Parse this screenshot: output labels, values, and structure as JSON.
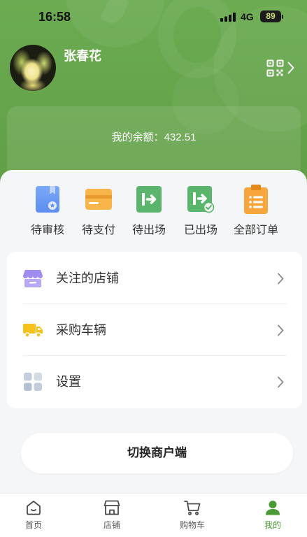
{
  "status_bar": {
    "time": "16:58",
    "network": "4G",
    "battery": "89"
  },
  "profile": {
    "name": "张春花",
    "qr_icon": "qr-code-icon"
  },
  "balance": {
    "label": "我的余额：",
    "value": "432.51"
  },
  "orders": [
    {
      "label": "待审核",
      "icon": "pending-review-icon",
      "color": "#6f9cf3"
    },
    {
      "label": "待支付",
      "icon": "pending-payment-icon",
      "color": "#f7b54a"
    },
    {
      "label": "待出场",
      "icon": "pending-exit-icon",
      "color": "#5bb56c"
    },
    {
      "label": "已出场",
      "icon": "exited-icon",
      "color": "#5bb56c"
    },
    {
      "label": "全部订单",
      "icon": "all-orders-icon",
      "color": "#f6a63d"
    }
  ],
  "menu": [
    {
      "label": "关注的店铺",
      "icon": "shop-icon",
      "color": "#9f8cf1"
    },
    {
      "label": "采购车辆",
      "icon": "truck-icon",
      "color": "#f6c21a"
    },
    {
      "label": "设置",
      "icon": "settings-grid-icon",
      "color": "#c3cedb"
    }
  ],
  "switch_button": {
    "label": "切换商户端"
  },
  "tabbar": [
    {
      "label": "首页",
      "icon": "home-icon",
      "active": false
    },
    {
      "label": "店铺",
      "icon": "store-icon",
      "active": false
    },
    {
      "label": "购物车",
      "icon": "cart-icon",
      "active": false
    },
    {
      "label": "我的",
      "icon": "profile-icon",
      "active": true
    }
  ],
  "colors": {
    "brand_green": "#66a84a",
    "active_tab": "#4a9a35",
    "page_bg": "#f5f6f8"
  }
}
